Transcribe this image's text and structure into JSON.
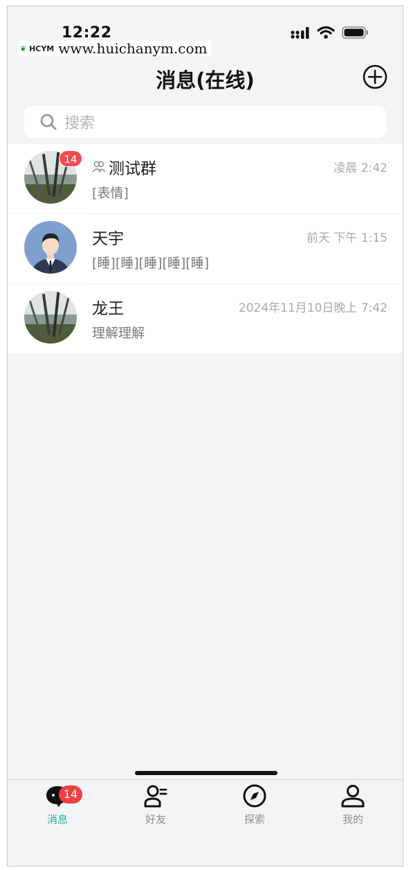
{
  "status_bar": {
    "time": "12:22"
  },
  "watermark": {
    "logo_text": "HCYM",
    "url": "www.huichanym.com"
  },
  "header": {
    "title": "消息(在线)"
  },
  "search": {
    "placeholder": "搜索"
  },
  "chats": [
    {
      "name": "测试群",
      "is_group": true,
      "time": "凌晨 2:42",
      "preview": "[表情]",
      "unread": "14",
      "avatar": "landscape-photo"
    },
    {
      "name": "天宇",
      "is_group": false,
      "time": "前天 下午 1:15",
      "preview": "[睡][睡][睡][睡][睡]",
      "unread": "",
      "avatar": "businessman-illustration"
    },
    {
      "name": "龙王",
      "is_group": false,
      "time": "2024年11月10日晚上 7:42",
      "preview": "理解理解",
      "unread": "",
      "avatar": "landscape-photo"
    }
  ],
  "tabs": [
    {
      "label": "消息",
      "icon": "message-bubble-icon",
      "active": true,
      "badge": "14"
    },
    {
      "label": "好友",
      "icon": "friends-icon",
      "active": false
    },
    {
      "label": "探索",
      "icon": "compass-icon",
      "active": false
    },
    {
      "label": "我的",
      "icon": "profile-icon",
      "active": false
    }
  ],
  "colors": {
    "accent": "#18b994",
    "badge": "#f04a4a",
    "background": "#f3f4f6"
  }
}
